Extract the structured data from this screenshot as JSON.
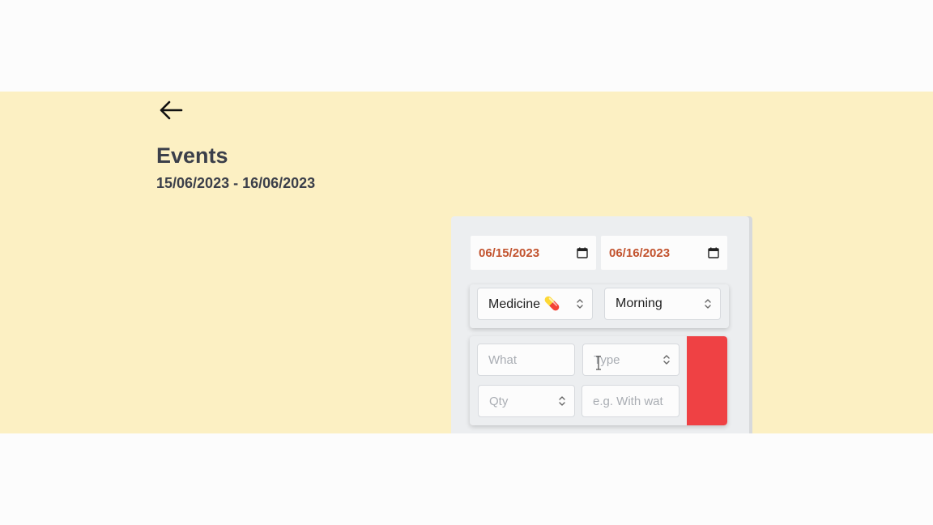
{
  "header": {
    "back_icon": "arrow-left-icon",
    "title": "Events",
    "date_range": "15/06/2023 - 16/06/2023"
  },
  "filters": {
    "date_from": "06/15/2023",
    "date_to": "06/16/2023",
    "calendar_icon": "calendar-icon"
  },
  "event": {
    "category": "Medicine 💊",
    "time_of_day": "Morning"
  },
  "item": {
    "what_placeholder": "What",
    "type_placeholder": "Type",
    "qty_placeholder": "Qty",
    "note_placeholder": "e.g. With wat"
  },
  "colors": {
    "background": "#fcf0c3",
    "date_text": "#c2532e",
    "remove_button": "#ef4144",
    "heading": "#3b3f4a"
  }
}
